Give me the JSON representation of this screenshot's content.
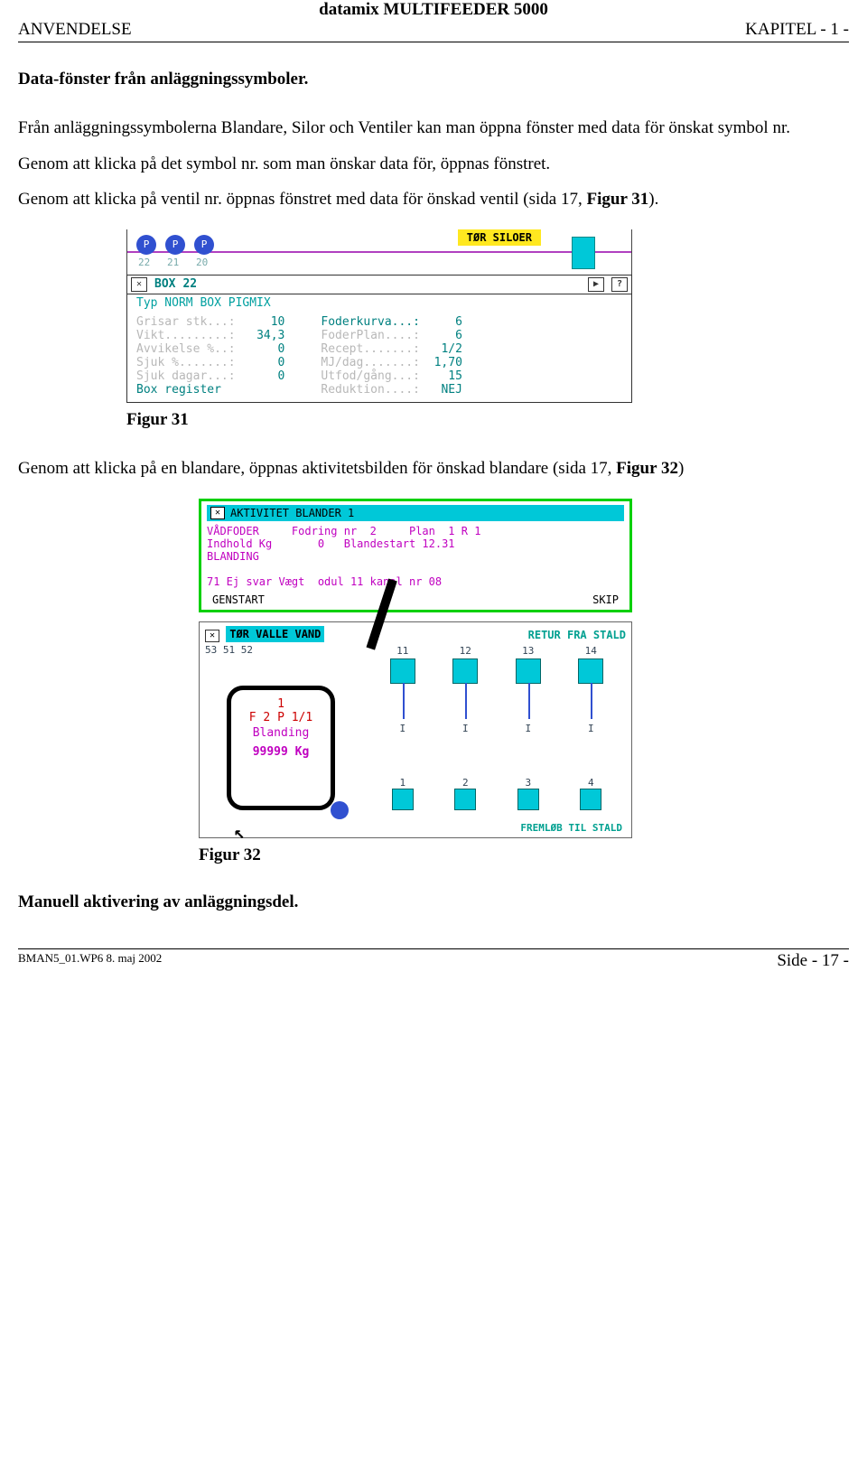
{
  "header": {
    "center_title": "datamix MULTIFEEDER 5000",
    "left": "ANVENDELSE",
    "right": "KAPITEL - 1 -"
  },
  "section1_heading": "Data-fönster från anläggningssymboler.",
  "para1": "Från anläggningssymbolerna Blandare, Silor och Ventiler kan man öppna fönster med data för önskat symbol nr.",
  "para2": "Genom att klicka på det symbol nr. som man önskar data för, öppnas fönstret.",
  "para3_a": "Genom att klicka på ventil nr. öppnas fönstret med data för önskad ventil (sida 17, ",
  "para3_b": "Figur 31",
  "para3_c": ").",
  "fig31": {
    "banner": "TØR SILOER",
    "circles": [
      "P",
      "P",
      "P"
    ],
    "circle_nums": [
      "22",
      "21",
      "20"
    ],
    "title_box": "BOX",
    "title_num": "22",
    "subtitle": "Typ   NORM BOX    PIGMIX",
    "left_labels": [
      "Grisar stk...:",
      "Vikt.........:",
      "Avvikelse %..:",
      "Sjuk %.......:",
      "Sjuk dagar...:",
      "Box register"
    ],
    "left_values": [
      "10",
      "34,3",
      "0",
      "0",
      "0",
      ""
    ],
    "right_labels": [
      "Foderkurva...:",
      "FoderPlan....:",
      "Recept.......:",
      "MJ/dag.......:",
      "Utfod/gång...:",
      "Reduktion....:"
    ],
    "right_values": [
      "6",
      "6",
      "1/2",
      "1,70",
      "15",
      "NEJ"
    ]
  },
  "fig31_caption": "Figur 31",
  "para4_a": "Genom att klicka på en blandare, öppnas aktivitetsbilden för önskad blandare (sida 17, ",
  "para4_b": "Figur 32",
  "para4_c": ")",
  "fig32": {
    "title": "AKTIVITET BLANDER   1",
    "line1": "VÅDFODER     Fodring nr  2     Plan  1 R 1",
    "line2": "Indhold Kg       0   Blandestart 12.31",
    "line3": "BLANDING",
    "errline": "71 Ej svar Vægt  odul 11 kanal nr 08",
    "btn_left": "GENSTART",
    "btn_right": "SKIP",
    "tag_labels": "TØR  VALLE  VAND",
    "tag_nums": "53   51   52",
    "retur": "RETUR FRA STALD",
    "top_valves": [
      "11",
      "12",
      "13",
      "14"
    ],
    "top_I": [
      "I",
      "I",
      "I",
      "I"
    ],
    "mixer_l1": "1",
    "mixer_l2": "F 2 P 1/1",
    "mixer_l3": "Blanding",
    "mixer_l4": "99999 Kg",
    "low_valves": [
      "1",
      "2",
      "3",
      "4"
    ],
    "fremlob": "FREMLØB TIL STALD"
  },
  "fig32_caption": "Figur 32",
  "section2_heading": "Manuell aktivering av anläggningsdel.",
  "footer": {
    "left": "BMAN5_01.WP6  8. maj 2002",
    "right": "Side - 17 -"
  }
}
